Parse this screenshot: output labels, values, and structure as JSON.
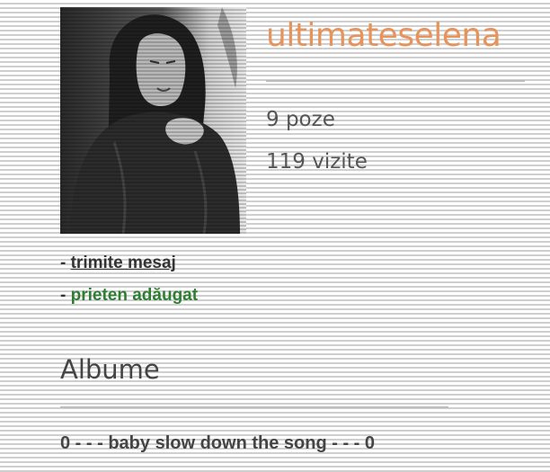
{
  "profile": {
    "username": "ultimateselena",
    "photos_count": "9 poze",
    "visits_count": "119 vizite"
  },
  "actions": {
    "message_prefix": "- ",
    "message_label": "trimite mesaj",
    "friend_prefix": "- ",
    "friend_label": "prieten adăugat"
  },
  "albums": {
    "heading": "Albume",
    "items": [
      {
        "label": "0 - - - baby slow down the song - - - 0"
      }
    ]
  },
  "colors": {
    "username": "#e8935a",
    "friend_added": "#2e7d32",
    "stripe": "#cfcfcf"
  }
}
